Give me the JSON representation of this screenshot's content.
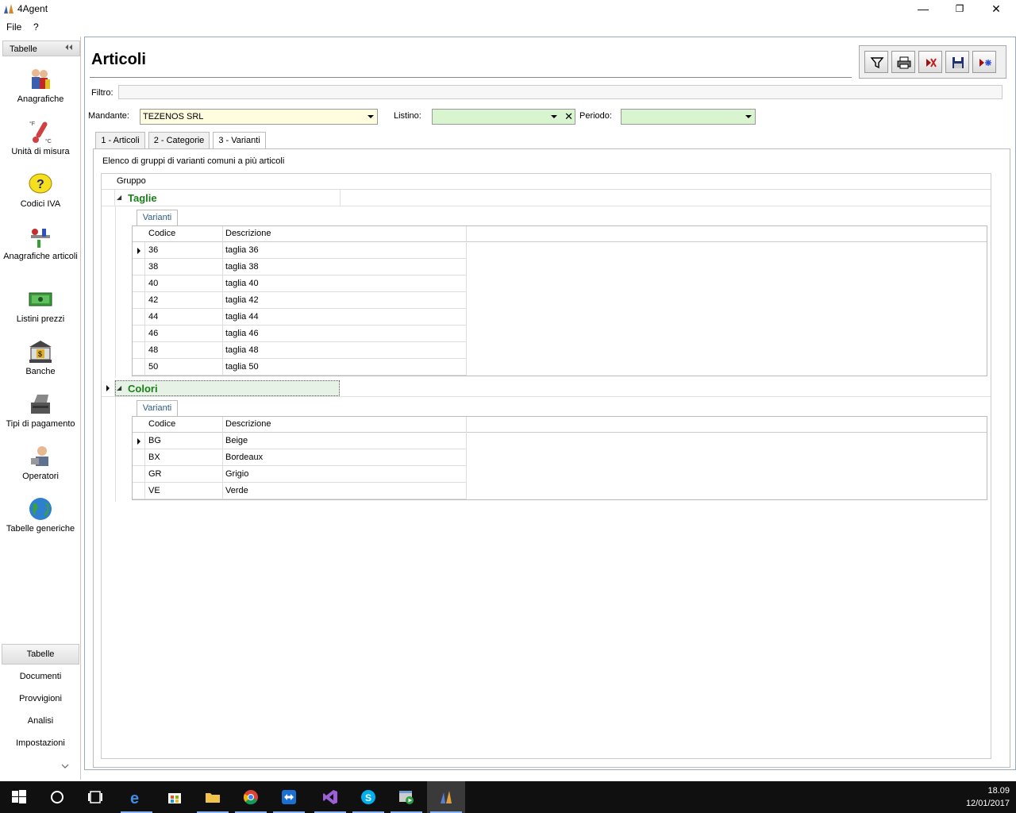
{
  "window": {
    "title": "4Agent",
    "minimize": "—",
    "restore": "❐",
    "close": "✕"
  },
  "menu": [
    "File",
    "?"
  ],
  "sidebar": {
    "header": "Tabelle",
    "items": [
      {
        "label": "Anagrafiche",
        "icon": "people-icon"
      },
      {
        "label": "Unità di misura",
        "icon": "thermometer-icon"
      },
      {
        "label": "Codici IVA",
        "icon": "question-icon"
      },
      {
        "label": "Anagrafiche articoli",
        "icon": "tools-icon"
      },
      {
        "label": "Listini prezzi",
        "icon": "money-icon"
      },
      {
        "label": "Banche",
        "icon": "bank-icon"
      },
      {
        "label": "Tipi di pagamento",
        "icon": "cash-register-icon"
      },
      {
        "label": "Operatori",
        "icon": "operator-icon"
      },
      {
        "label": "Tabelle generiche",
        "icon": "globe-icon"
      }
    ],
    "bottom": [
      "Tabelle",
      "Documenti",
      "Provvigioni",
      "Analisi",
      "Impostazioni"
    ]
  },
  "page": {
    "title": "Articoli",
    "filter_label": "Filtro:",
    "filter_value": "",
    "mandante_label": "Mandante:",
    "mandante_value": "TEZENOS SRL",
    "listino_label": "Listino:",
    "listino_value": "",
    "periodo_label": "Periodo:",
    "periodo_value": "",
    "tabs": [
      "1 - Articoli",
      "2 - Categorie",
      "3 - Varianti"
    ],
    "active_tab": 2,
    "description": "Elenco di gruppi di varianti comuni a più articoli",
    "grid_header": "Gruppo",
    "groups": [
      {
        "name": "Taglie",
        "subtab": "Varianti",
        "columns": [
          "Codice",
          "Descrizione"
        ],
        "rows": [
          [
            "36",
            "taglia 36"
          ],
          [
            "38",
            "taglia 38"
          ],
          [
            "40",
            "taglia 40"
          ],
          [
            "42",
            "taglia 42"
          ],
          [
            "44",
            "taglia 44"
          ],
          [
            "46",
            "taglia 46"
          ],
          [
            "48",
            "taglia 48"
          ],
          [
            "50",
            "taglia 50"
          ]
        ]
      },
      {
        "name": "Colori",
        "subtab": "Varianti",
        "columns": [
          "Codice",
          "Descrizione"
        ],
        "rows": [
          [
            "BG",
            "Beige"
          ],
          [
            "BX",
            "Bordeaux"
          ],
          [
            "GR",
            "Grigio"
          ],
          [
            "VE",
            "Verde"
          ]
        ]
      }
    ]
  },
  "toolbar": [
    "filter-icon",
    "print-icon",
    "delete-icon",
    "save-icon",
    "new-icon"
  ],
  "taskbar": {
    "time": "18.09",
    "date": "12/01/2017"
  },
  "colors": {
    "mandante_bg": "#fffde0",
    "listino_bg": "#d8f5d0",
    "group_text": "#1a7f1a"
  }
}
